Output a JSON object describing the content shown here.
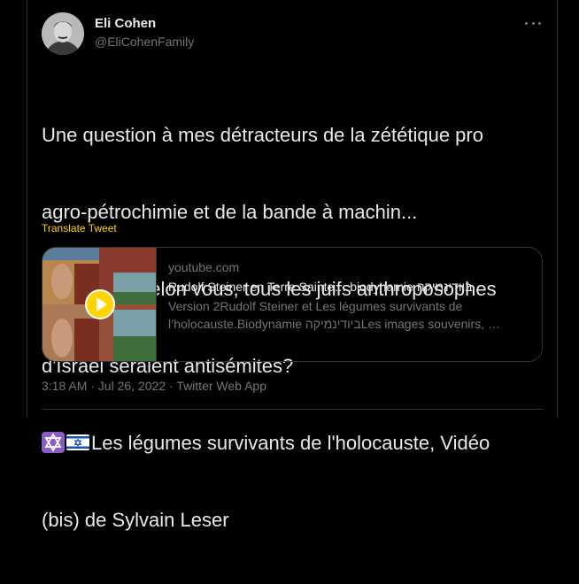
{
  "tweet": {
    "author_name": "Eli Cohen",
    "author_handle": "@EliCohenFamily",
    "text_lines": [
      "Une question à mes détracteurs de la zététique pro",
      "agro-pétrochimie et de la bande à machin...",
      "Est-ce que selon vous, tous les juifs anthroposophes",
      "d'Israël seraient antisémites?",
      "Les légumes survivants de l'holocauste, Vidéo",
      "(bis) de Sylvain Leser"
    ],
    "emojis": [
      "star-of-david",
      "israel-flag"
    ],
    "translate_label": "Translate Tweet",
    "timestamp": "3:18 AM · Jul 26, 2022",
    "separator": " · ",
    "source": "Twitter Web App"
  },
  "card": {
    "domain": "youtube.com",
    "title": "Rudolf Steiner en Terre Sainte… biodynamie ביודינמיקה",
    "description": "Version 2Rudolf Steiner et Les légumes survivants de l’holocauste.Biodynamie ביודינמיקהLes images souvenirs, …",
    "play_icon": "play-circle-icon"
  },
  "colors": {
    "background": "#000000",
    "text": "#e7e9ea",
    "muted": "#71767b",
    "accent": "#ffd400",
    "border": "#2f3336"
  }
}
